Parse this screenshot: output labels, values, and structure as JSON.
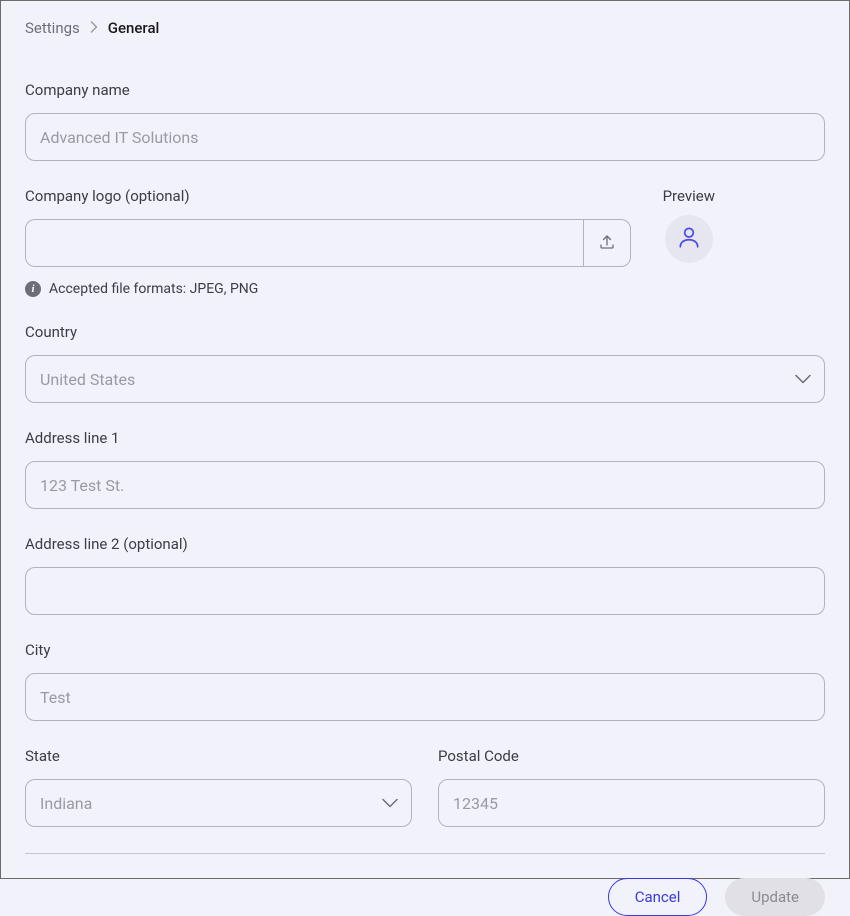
{
  "breadcrumb": {
    "parent": "Settings",
    "current": "General"
  },
  "companyName": {
    "label": "Company name",
    "placeholder": "Advanced IT Solutions",
    "value": ""
  },
  "companyLogo": {
    "label": "Company logo (optional)",
    "helper": "Accepted file formats: JPEG, PNG",
    "previewLabel": "Preview"
  },
  "country": {
    "label": "Country",
    "value": "United States"
  },
  "address1": {
    "label": "Address line 1",
    "placeholder": "123 Test St.",
    "value": ""
  },
  "address2": {
    "label": "Address line 2 (optional)",
    "value": ""
  },
  "city": {
    "label": "City",
    "placeholder": "Test",
    "value": ""
  },
  "state": {
    "label": "State",
    "value": "Indiana"
  },
  "postalCode": {
    "label": "Postal Code",
    "placeholder": "12345",
    "value": ""
  },
  "actions": {
    "cancel": "Cancel",
    "update": "Update"
  }
}
